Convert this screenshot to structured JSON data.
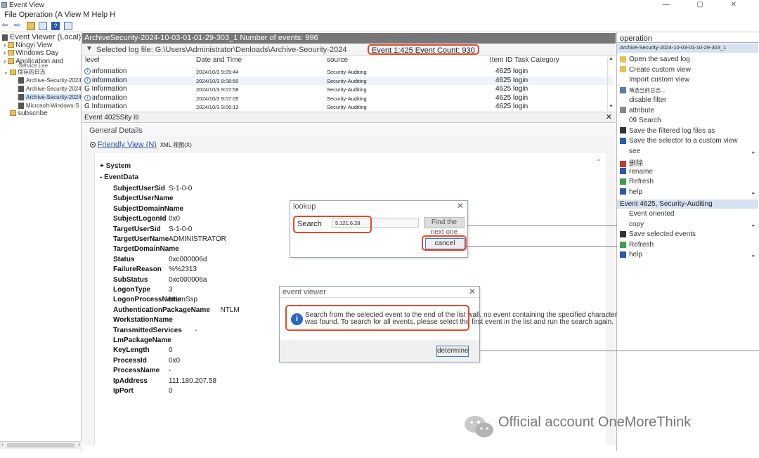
{
  "window": {
    "title": "Event View",
    "controls": "— ▢ ✕"
  },
  "menu": {
    "text": "File Operation (A View M Help H"
  },
  "tree": {
    "root": "Event Viewer (Local)",
    "items": [
      "Ningyi View",
      "Windows Day",
      "Application and",
      "保存的日志"
    ],
    "overlay": "Service Lee",
    "logs": [
      "Archive-Security-2024",
      "Archive-Security-2024",
      "Archive-Security-2024",
      "Microsoft-Windows-S"
    ],
    "subscribe": "subscribe"
  },
  "log": {
    "header": "ArchiveSecurity-2024-10-03-01-01-29-303_1 Number of events: 996",
    "filter_text": "Selected log file: G:\\Users\\Administrator\\Denloads\\Archive-Seourity-2024",
    "event_count": "Event 1:425 Event Count: 930",
    "columns": [
      "level",
      "Date and Time",
      "source",
      "Item ID Task Category"
    ],
    "rows": [
      {
        "level": "information",
        "date": "2024/10/3 9:09:44",
        "source": "Security-Auditing",
        "task": "4625 login"
      },
      {
        "level": "information",
        "date": "2024/10/3 9:08:50",
        "source": "Security-Auditing",
        "task": "4625 login"
      },
      {
        "level": "G Information",
        "date": "2024/10/3 9:07:58",
        "source": "Security-Auditing",
        "task": "4625 login"
      },
      {
        "level": "information",
        "date": "2024/10/3 9:07:05",
        "source": "Security-Auditing",
        "task": "4625 login"
      },
      {
        "level": "G Information",
        "date": "2024/10/3 9:06:13",
        "source": "Security-Auditing",
        "task": "4625 login"
      }
    ]
  },
  "detail": {
    "header": "Event 4025Sity iti",
    "tab": "General Details",
    "friendly": "Friendly View (N)",
    "xml": "XML 视图(X)",
    "system": "+ System",
    "eventdata": "- EventData",
    "fields": [
      {
        "k": "SubjectUserSid",
        "v": "S-1-0-0"
      },
      {
        "k": "SubjectUserName",
        "v": "-"
      },
      {
        "k": "SubjectDomainName",
        "v": "-"
      },
      {
        "k": "SubjectLogonId",
        "v": "0x0"
      },
      {
        "k": "TargetUserSid",
        "v": "S-1-0-0"
      },
      {
        "k": "TargetUserName",
        "v": "ADMINISTRATOR"
      },
      {
        "k": "TargetDomainName",
        "v": ""
      },
      {
        "k": "Status",
        "v": "0xc000006d"
      },
      {
        "k": "FailureReason",
        "v": "%%2313"
      },
      {
        "k": "SubStatus",
        "v": "0xc000006a"
      },
      {
        "k": "LogonType",
        "v": "3"
      },
      {
        "k": "LogonProcessName",
        "v": "NtLmSsp"
      },
      {
        "k": "AuthenticationPackageName",
        "v": "NTLM"
      },
      {
        "k": "WorkstationName",
        "v": "-"
      },
      {
        "k": "TransmittedServices",
        "v": "-"
      },
      {
        "k": "LmPackageName",
        "v": "-"
      },
      {
        "k": "KeyLength",
        "v": "0"
      },
      {
        "k": "ProcessId",
        "v": "0x0"
      },
      {
        "k": "ProcessName",
        "v": "-"
      },
      {
        "k": "IpAddress",
        "v": "111.180.207.58"
      },
      {
        "k": "IpPort",
        "v": "0"
      }
    ]
  },
  "right": {
    "header1": "operation",
    "sub1": "Archive-Security-2024-10-03-01-10-29-303_1",
    "items1": [
      "Open the saved log",
      "Create custom view",
      "Import custom view",
      "筛选当前日志...",
      "disable filter",
      "attribute",
      "09 Search",
      "Save the filtered log files as",
      "Save the selector to a custom view",
      "see",
      "删除",
      "rename",
      "Refresh",
      "help"
    ],
    "header2": "Event 4625, Security-Auditing",
    "items2": [
      "Event oriented",
      "copy",
      "Save selected events",
      "Refresh",
      "help"
    ]
  },
  "find_dialog": {
    "title": "lookup",
    "label": "Search",
    "value": "5.121.6.28",
    "next": "Find the next one",
    "cancel": "cancel"
  },
  "msg_dialog": {
    "title": "event viewer",
    "message": "Search from the selected event to the end of the list wall, no event containing the specified character was found. To search for all events, please select the first event in the list and run the search again.",
    "ok": "determine"
  },
  "watermark": "Official account OneMoreThink"
}
